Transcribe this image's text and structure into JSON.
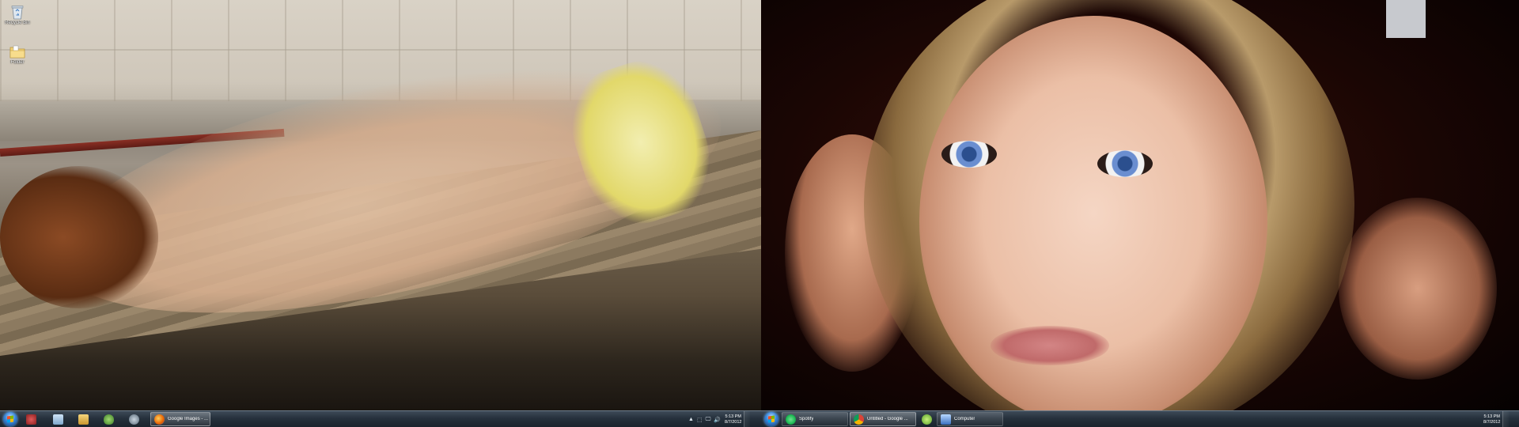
{
  "desktop_icons": [
    {
      "name": "Recycle Bin",
      "icon": "recycle-bin-icon"
    },
    {
      "name": "Folder",
      "icon": "folder-icon"
    }
  ],
  "left_taskbar": {
    "pinned": [
      {
        "icon": "start-orb-icon"
      },
      {
        "icon": "media-player-icon"
      },
      {
        "icon": "notepad-icon"
      },
      {
        "icon": "explorer-folder-icon"
      },
      {
        "icon": "security-shield-icon"
      },
      {
        "icon": "steam-icon"
      }
    ],
    "windows": [
      {
        "label": "Google Images - ...",
        "icon": "firefox-icon"
      }
    ],
    "tray": {
      "icons": [
        "▲",
        "⬚",
        "🖵",
        "🔊"
      ],
      "time": "5:13 PM",
      "date": "8/7/2012"
    }
  },
  "right_taskbar": {
    "windows": [
      {
        "label": "Spotify",
        "icon": "spotify-icon"
      },
      {
        "label": "Untitled - Google ...",
        "icon": "chrome-icon"
      },
      {
        "label": "",
        "icon": "green-app-icon"
      },
      {
        "label": "Computer",
        "icon": "computer-icon"
      }
    ],
    "clock": {
      "time": "5:13 PM",
      "date": "8/7/2012"
    }
  },
  "colors": {
    "taskbar": "#26313c",
    "start_orb": "#3b86d6",
    "firefox": "#e66000",
    "chrome": "#db4437",
    "spotify": "#1db954"
  }
}
